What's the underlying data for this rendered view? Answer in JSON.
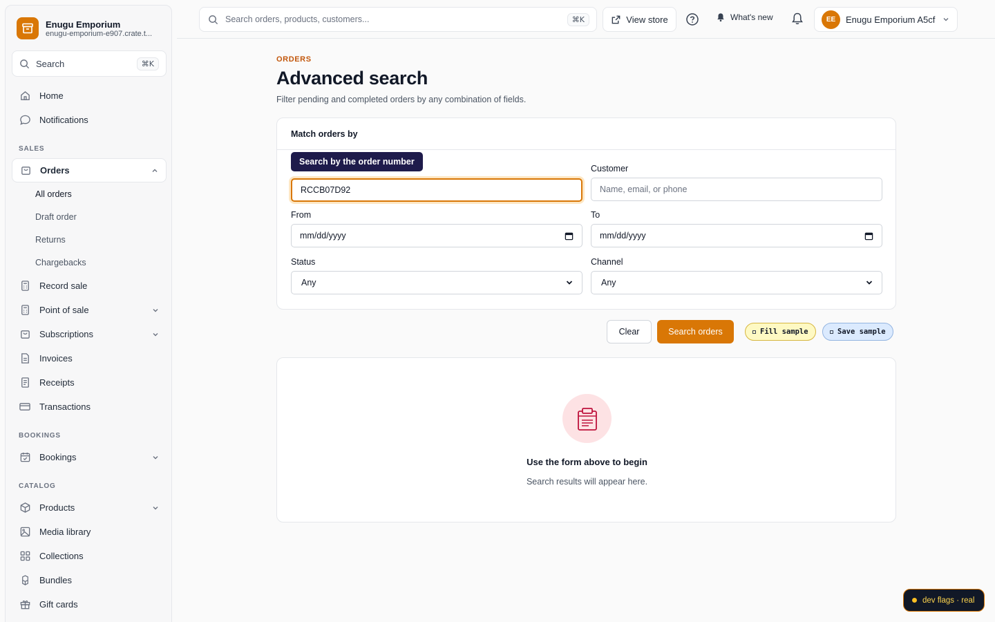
{
  "brand": {
    "name": "Enugu Emporium",
    "subdomain": "enugu-emporium-e907.crate.t..."
  },
  "sidebar": {
    "search_label": "Search",
    "search_shortcut": "⌘K",
    "home": "Home",
    "notifications": "Notifications",
    "section_sales": "SALES",
    "orders": "Orders",
    "orders_sub": {
      "all_orders": "All orders",
      "draft_order": "Draft order",
      "returns": "Returns",
      "chargebacks": "Chargebacks"
    },
    "record_sale": "Record sale",
    "point_of_sale": "Point of sale",
    "subscriptions": "Subscriptions",
    "invoices": "Invoices",
    "receipts": "Receipts",
    "transactions": "Transactions",
    "section_bookings": "BOOKINGS",
    "bookings": "Bookings",
    "section_catalog": "CATALOG",
    "products": "Products",
    "media_library": "Media library",
    "collections": "Collections",
    "bundles": "Bundles",
    "gift_cards": "Gift cards"
  },
  "topbar": {
    "search_placeholder": "Search orders, products, customers...",
    "search_shortcut": "⌘K",
    "view_store": "View store",
    "whats_new": "What's new",
    "account_initials": "EE",
    "account_name": "Enugu Emporium A5cf"
  },
  "main": {
    "eyebrow": "ORDERS",
    "title": "Advanced search",
    "description": "Filter pending and completed orders by any combination of fields.",
    "card_title": "Match orders by",
    "tooltip": "Search by the order number",
    "order_number_value": "RCCB07D92",
    "customer_label": "Customer",
    "customer_placeholder": "Name, email, or phone",
    "from_label": "From",
    "from_value": "mm/dd/yyyy",
    "to_label": "To",
    "to_value": "mm/dd/yyyy",
    "status_label": "Status",
    "status_value": "Any",
    "channel_label": "Channel",
    "channel_value": "Any",
    "clear_button": "Clear",
    "search_button": "Search orders",
    "fill_sample": "Fill sample",
    "save_sample": "Save sample",
    "empty_title": "Use the form above to begin",
    "empty_sub": "Search results will appear here."
  },
  "dev_flags": "dev flags · real",
  "colors": {
    "accent": "#d97706",
    "tooltip_bg": "#1e1b4b"
  }
}
